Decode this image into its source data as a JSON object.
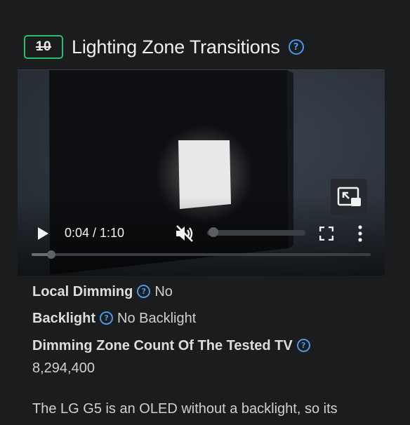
{
  "header": {
    "score": "10",
    "title": "Lighting Zone Transitions",
    "help_icon": "help-circle-icon"
  },
  "video": {
    "current_time": "0:04",
    "duration": "1:10",
    "time_text": "0:04 / 1:10",
    "progress_fraction": 0.057,
    "muted": true,
    "icons": {
      "play": "play-icon",
      "mute": "volume-muted-icon",
      "fullscreen": "fullscreen-icon",
      "more": "more-vertical-icon",
      "pip": "picture-in-picture-icon"
    }
  },
  "specs": [
    {
      "label": "Local Dimming",
      "value": "No"
    },
    {
      "label": "Backlight",
      "value": "No Backlight"
    },
    {
      "label": "Dimming Zone Count Of The Tested TV",
      "value": "8,294,400"
    }
  ],
  "description": "The LG G5 is an OLED without a backlight, so its",
  "colors": {
    "background": "#1b1c1e",
    "score_border": "#27c06a",
    "help_icon": "#4a97e8",
    "text": "#d5d6d8"
  }
}
